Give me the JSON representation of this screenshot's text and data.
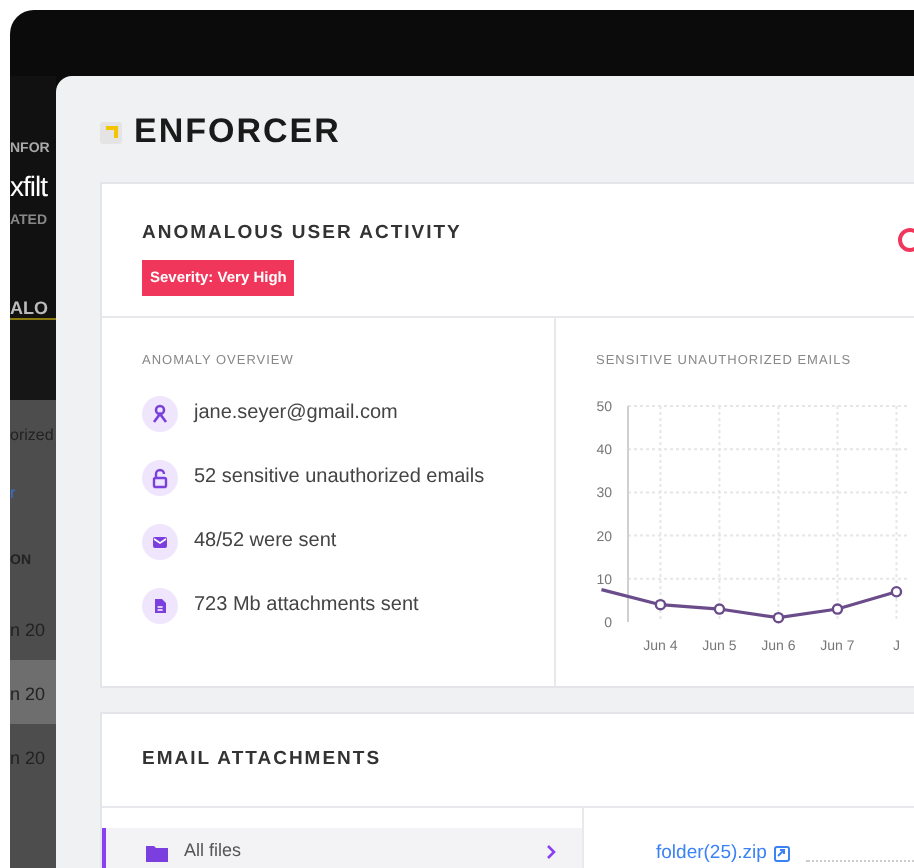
{
  "background_app": {
    "fragments": [
      {
        "kind": "label",
        "text": "NFOR"
      },
      {
        "kind": "title",
        "text": "xfilt"
      },
      {
        "kind": "subtitle",
        "text": "ATED"
      },
      {
        "kind": "tab",
        "text": "ALO"
      },
      {
        "kind": "text",
        "text": "orized"
      },
      {
        "kind": "link",
        "text": "r"
      },
      {
        "kind": "column",
        "text": "ON"
      }
    ],
    "rows": [
      {
        "text": "n 20",
        "selected": false
      },
      {
        "text": "n 20",
        "selected": true
      },
      {
        "text": "n 20",
        "selected": false
      }
    ]
  },
  "app": {
    "title": "ENFORCER"
  },
  "activity": {
    "title": "ANOMALOUS USER ACTIVITY",
    "severity": "Severity: Very High",
    "overview": {
      "title": "ANOMALY OVERVIEW",
      "items": [
        {
          "kind": "user",
          "text": "jane.seyer@gmail.com"
        },
        {
          "kind": "lock",
          "text": "52 sensitive unauthorized emails"
        },
        {
          "kind": "mail",
          "text": "48/52 were sent"
        },
        {
          "kind": "file",
          "text": "723 Mb attachments sent"
        }
      ]
    },
    "chart_data": {
      "type": "line",
      "title": "SENSITIVE UNAUTHORIZED EMAILS",
      "categories": [
        null,
        "Jun 4",
        "Jun 5",
        "Jun 6",
        "Jun 7",
        "J"
      ],
      "series": [
        {
          "color": "#6b4c8a",
          "marker": "circle",
          "values": [
            7.5,
            4,
            3,
            1,
            3,
            7
          ]
        }
      ],
      "grid": true,
      "ylim": [
        0,
        50
      ],
      "yticks": [
        0,
        10,
        20,
        30,
        40,
        50
      ]
    }
  },
  "attachments": {
    "title": "EMAIL ATTACHMENTS",
    "folders": [
      {
        "label": "All files",
        "selected": true
      }
    ],
    "files": [
      {
        "name": "folder(25).zip"
      }
    ]
  }
}
